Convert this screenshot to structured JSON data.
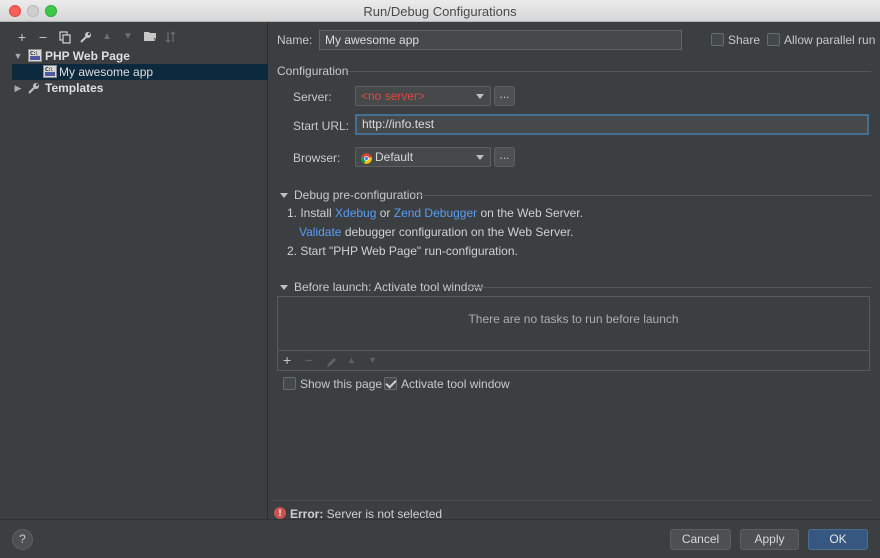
{
  "window": {
    "title": "Run/Debug Configurations"
  },
  "left_toolbar": {
    "icons": [
      "plus-icon",
      "minus-icon",
      "copy-icon",
      "wrench-icon",
      "move-up-icon",
      "move-down-icon",
      "folder-icon",
      "sort-icon"
    ]
  },
  "tree": {
    "group_label": "PHP Web Page",
    "item_label": "My awesome app",
    "templates_label": "Templates"
  },
  "form": {
    "name_label": "Name:",
    "name_value": "My awesome app",
    "share_label": "Share",
    "allow_parallel_label": "Allow parallel run",
    "configuration_title": "Configuration",
    "server_label": "Server:",
    "server_value": "<no server>",
    "server_ellipsis": "...",
    "start_url_label": "Start URL:",
    "start_url_value": "http://info.test",
    "browser_label": "Browser:",
    "browser_value": "Default",
    "browser_ellipsis": "..."
  },
  "debug_preconfig": {
    "title": "Debug pre-configuration",
    "step1_prefix": "1. Install ",
    "step1_link1": "Xdebug",
    "step1_or": " or ",
    "step1_link2": "Zend Debugger",
    "step1_suffix": " on the Web Server.",
    "validate_link": "Validate",
    "validate_suffix": " debugger configuration on the Web Server.",
    "step2": "2. Start \"PHP Web Page\" run-configuration."
  },
  "before_launch": {
    "title": "Before launch: Activate tool window",
    "empty_message": "There are no tasks to run before launch",
    "show_page_label": "Show this page",
    "activate_tool_label": "Activate tool window"
  },
  "error": {
    "prefix": "Error:",
    "message": " Server is not selected"
  },
  "buttons": {
    "help": "?",
    "cancel": "Cancel",
    "apply": "Apply",
    "ok": "OK"
  },
  "colors": {
    "error_text": "#e2483e",
    "link": "#589df6",
    "selection": "#0d293e",
    "primary_button": "#365880"
  }
}
